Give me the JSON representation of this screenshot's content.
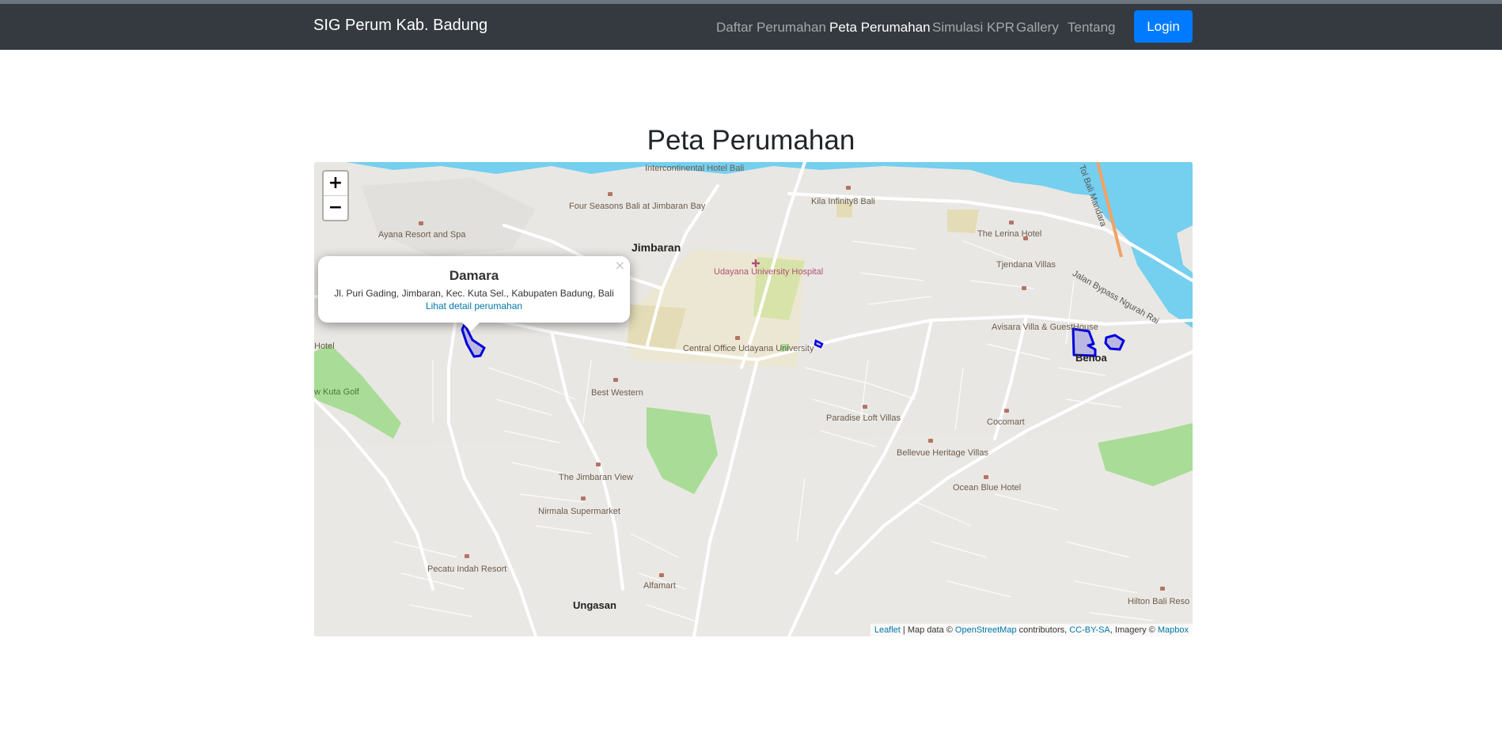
{
  "navbar": {
    "brand": "SIG Perum Kab. Badung",
    "links": [
      {
        "label": "Daftar Perumahan",
        "active": false
      },
      {
        "label": "Peta Perumahan",
        "active": true
      },
      {
        "label": "Simulasi KPR",
        "active": false
      },
      {
        "label": "Gallery",
        "active": false
      },
      {
        "label": "Tentang",
        "active": false
      }
    ],
    "login_label": "Login"
  },
  "page": {
    "title": "Peta Perumahan"
  },
  "map": {
    "zoom_in": "+",
    "zoom_out": "−",
    "popup": {
      "title": "Damara",
      "address": "Jl. Puri Gading, Jimbaran, Kec. Kuta Sel., Kabupaten Badung, Bali",
      "link": "Lihat detail perumahan",
      "close": "×"
    },
    "attribution": {
      "leaflet": "Leaflet",
      "sep1": " | Map data © ",
      "osm": "OpenStreetMap",
      "contrib": " contributors, ",
      "license": "CC-BY-SA",
      "imagery": ", Imagery © ",
      "mapbox": "Mapbox"
    },
    "labels": {
      "intercontinental": "Intercontinental Hotel Bali",
      "four_seasons": "Four Seasons Bali at Jimbaran Bay",
      "kila": "Kila Infinity8 Bali",
      "ayana": "Ayana Resort and Spa",
      "jimbaran": "Jimbaran",
      "udayana_hosp": "Udayana University Hospital",
      "lerina": "The Lerina Hotel",
      "tjendana": "Tjendana Villas",
      "bypass": "Jalan Bypass Ngurah Rai",
      "tol": "Tol Bali Mandara",
      "avisara": "Avisara Villa & GuestHouse",
      "benoa": "Benoa",
      "central_office": "Central Office Udayana University",
      "best_western": "Best Western",
      "hotel": "Hotel",
      "kuta_golf": "w Kuta Golf",
      "paradise": "Paradise Loft Villas",
      "cocomart": "Cocomart",
      "bellevue": "Bellevue Heritage Villas",
      "ocean_blue": "Ocean Blue Hotel",
      "jimbaran_view": "The Jimbaran View",
      "nirmala": "Nirmala Supermarket",
      "pecatu": "Pecatu Indah Resort",
      "alfamart": "Alfamart",
      "ungasan": "Ungasan",
      "hilton": "Hilton Bali Reso"
    }
  },
  "colors": {
    "navbar": "#343a40",
    "primary": "#007bff",
    "polygon": "#0000dd",
    "water": "#75cfef",
    "park": "#a8dc97"
  }
}
